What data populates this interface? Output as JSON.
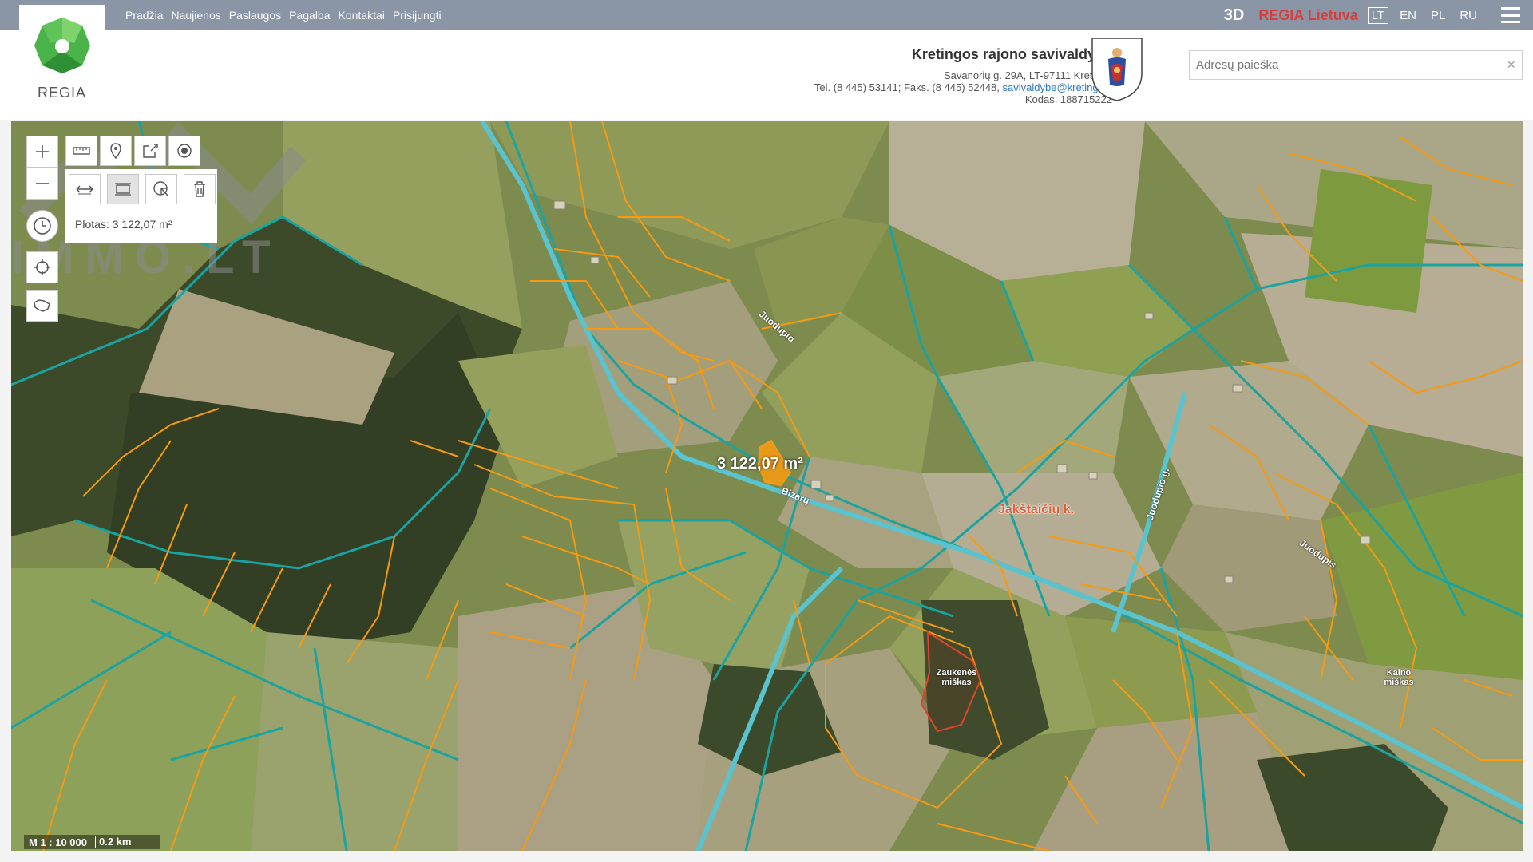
{
  "nav": {
    "items": [
      "Pradžia",
      "Naujienos",
      "Paslaugos",
      "Pagalba",
      "Kontaktai",
      "Prisijungti"
    ],
    "btn_3d": "3D",
    "regia_lietuva": "REGIA Lietuva",
    "languages": [
      "LT",
      "EN",
      "PL",
      "RU"
    ],
    "active_language": "LT"
  },
  "logo": {
    "text": "REGIA"
  },
  "municipality": {
    "name": "Kretingos rajono savivaldybė",
    "address": "Savanorių g. 29A, LT-97111 Kretinga",
    "contacts_prefix": "Tel. (8 445) 53141; Faks. (8 445) 52448, ",
    "email": "savivaldybe@kretinga.lt",
    "code": "Kodas: 188715222"
  },
  "search": {
    "placeholder": "Adresų paieška",
    "value": "",
    "clear_icon": "×"
  },
  "map": {
    "measure_result": "Plotas: 3 122,07 m²",
    "area_label": "3 122,07 m²",
    "labels": {
      "village": "Jakštaičių k.",
      "forest_1": "Zaukenės miškas",
      "forest_2": "Kaino miškas",
      "road_1": "Juodupio",
      "road_2": "Juodupio g.",
      "river": "Juodupis",
      "road_3": "Bizarų"
    },
    "scale": "M 1 : 10 000",
    "scale_distance": "0.2 km",
    "colors": {
      "parcel_border": "#f59a12",
      "cadastre_border": "#1aa3a0",
      "road": "#3fb8c6"
    }
  },
  "watermark": {
    "text": "IMMO.LT"
  }
}
